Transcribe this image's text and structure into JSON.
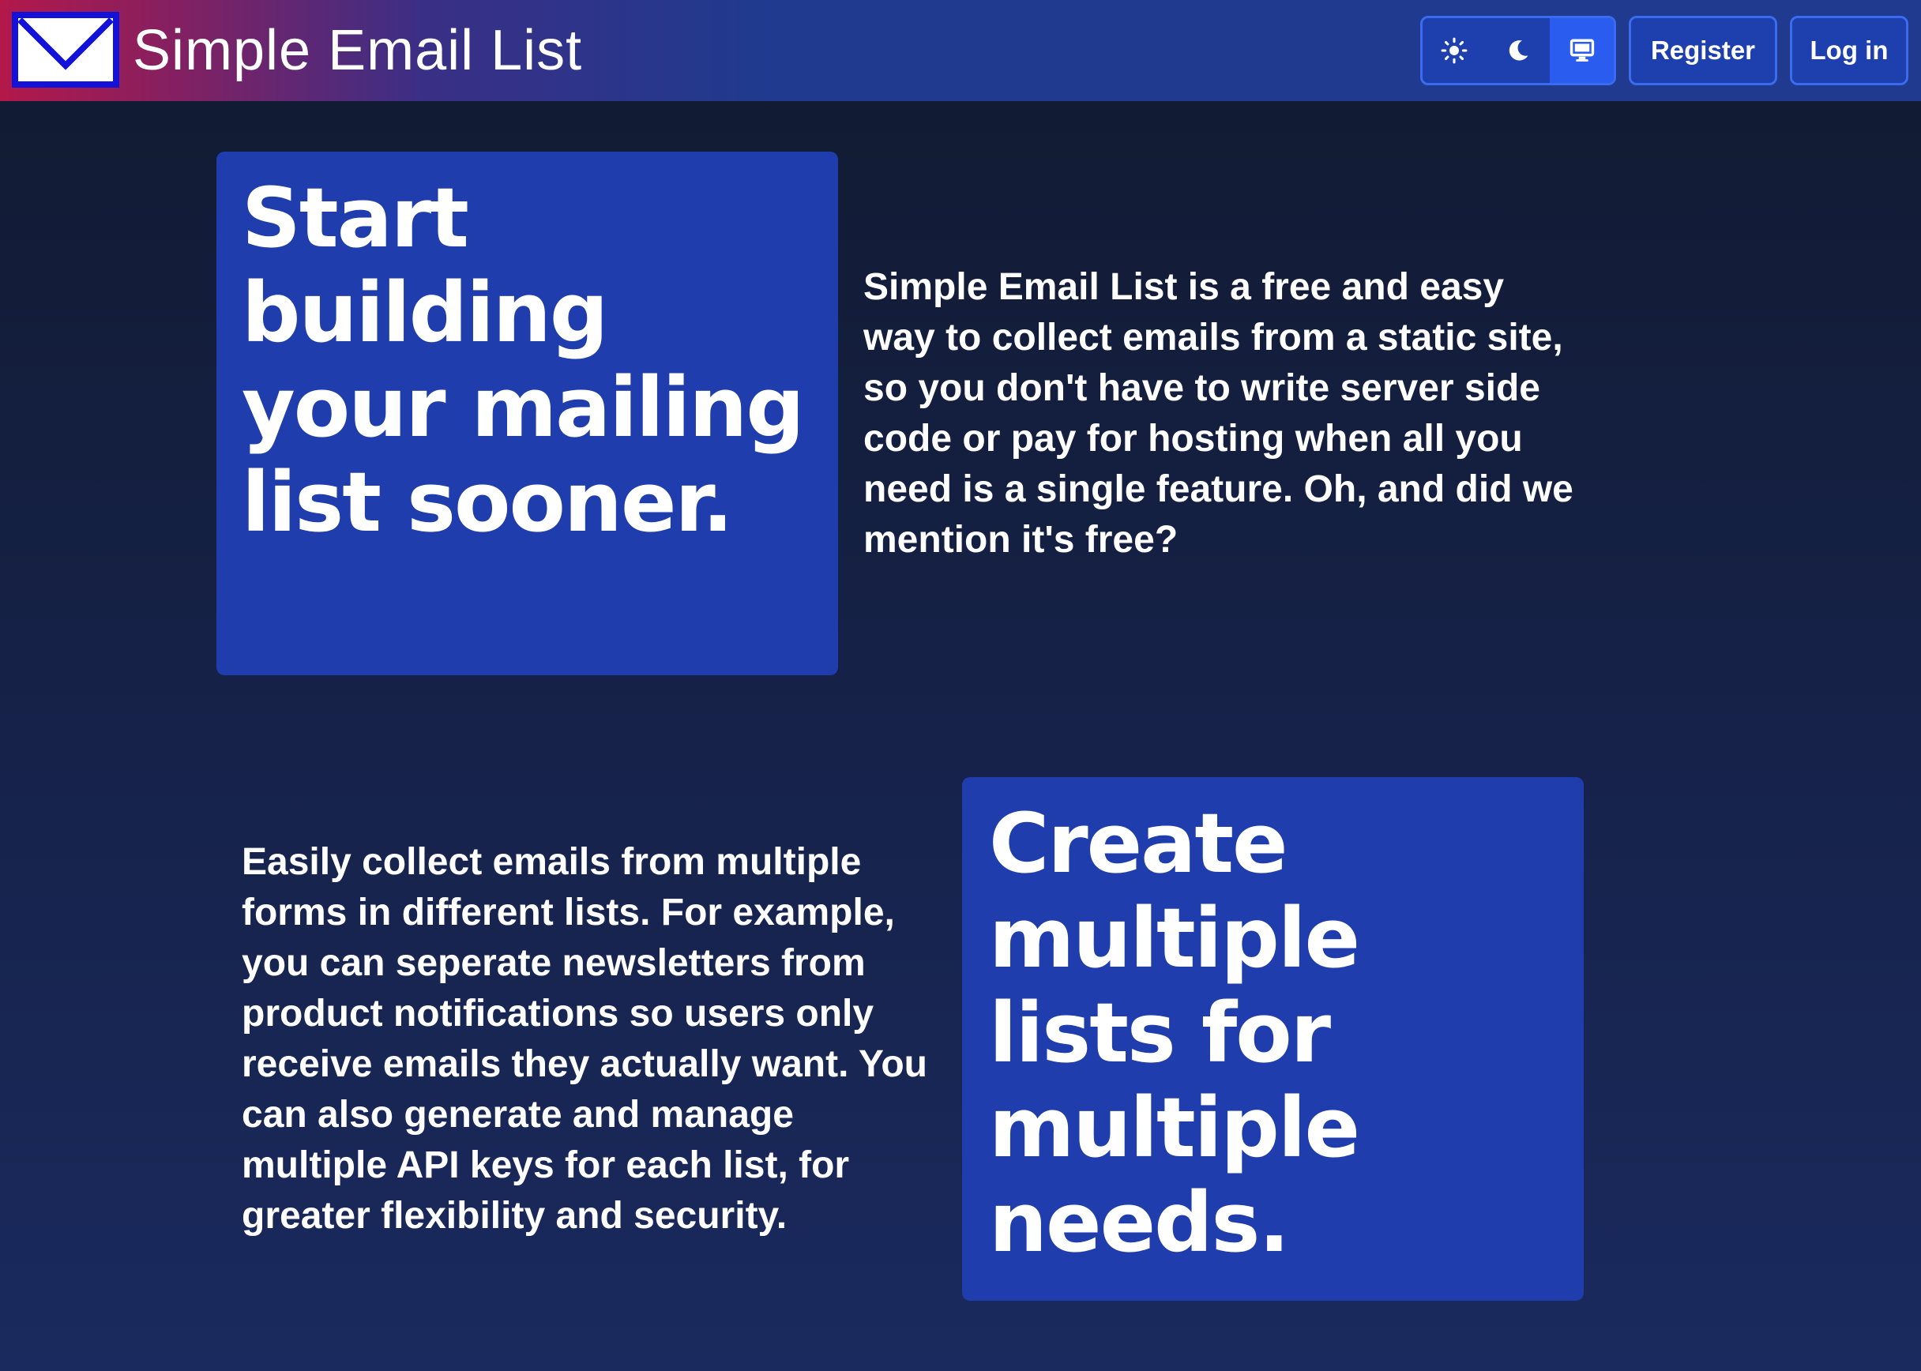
{
  "header": {
    "brand_title": "Simple Email List",
    "logo_icon": "envelope-icon",
    "theme_toggle": [
      {
        "name": "light",
        "icon": "sun-icon",
        "active": false
      },
      {
        "name": "dark",
        "icon": "moon-icon",
        "active": false
      },
      {
        "name": "system",
        "icon": "monitor-icon",
        "active": true
      }
    ],
    "register_label": "Register",
    "login_label": "Log in"
  },
  "sections": [
    {
      "heading": "Start building your mailing list sooner.",
      "body": "Simple Email List is a free and easy way to collect emails from a static site, so you don't have to write server side code or pay for hosting when all you need is a single feature. Oh, and did we mention it's free?"
    },
    {
      "heading": "Create multiple lists for multiple needs.",
      "body": "Easily collect emails from multiple forms in different lists. For example, you can seperate newsletters from product notifications so users only receive emails they actually want. You can also generate and manage multiple API keys for each list, for greater flexibility and security."
    }
  ],
  "colors": {
    "header_gradient_start": "#b3184a",
    "header_base": "#1f3a8e",
    "card_background": "#1f3dac",
    "button_background": "#1e3fae",
    "button_border": "#3b6cf0",
    "active_toggle": "#2a5cf0",
    "page_background": "#111a30",
    "logo_border": "#1212d8"
  }
}
